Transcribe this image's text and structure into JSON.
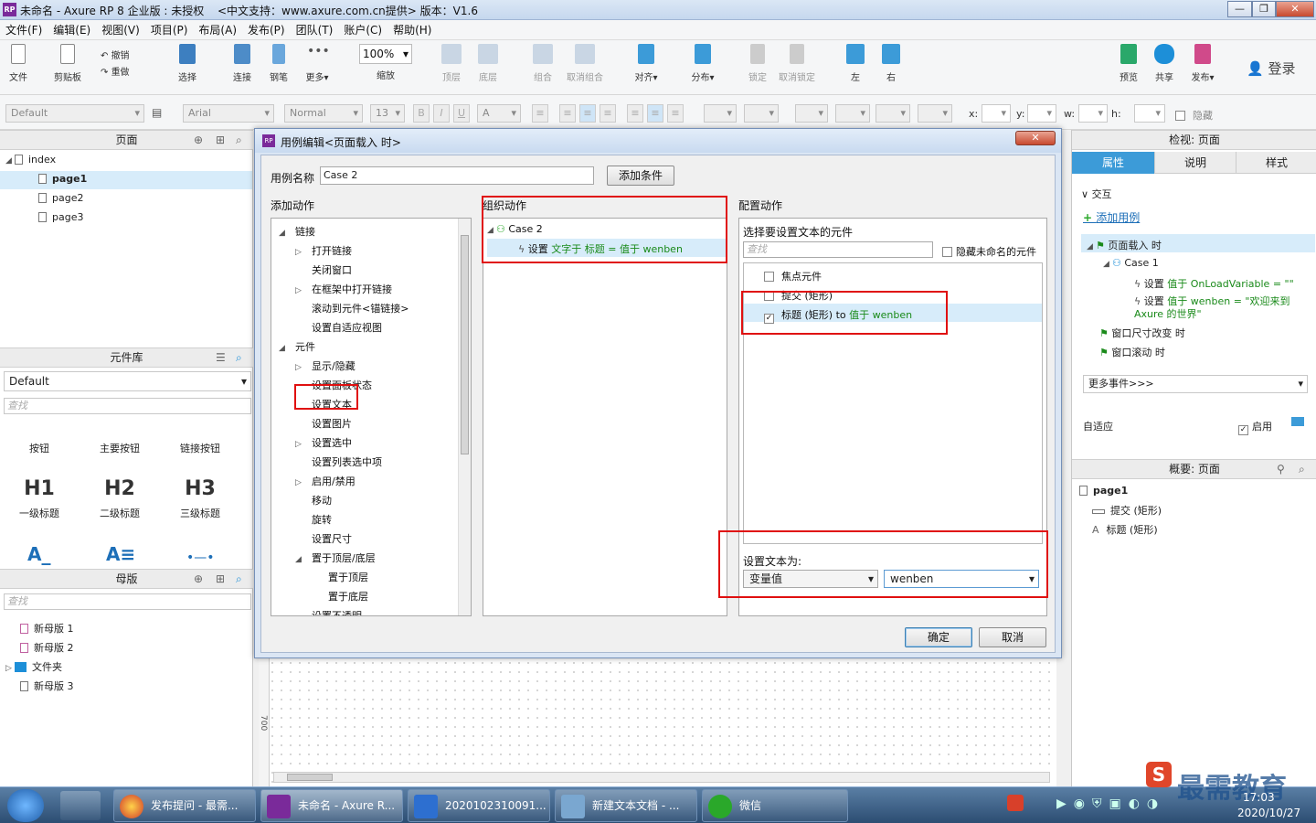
{
  "window": {
    "title": "未命名 - Axure RP 8 企业版 : 未授权",
    "subtitle": "<中文支持：www.axure.com.cn提供> 版本：V1.6"
  },
  "menu": [
    "文件(F)",
    "编辑(E)",
    "视图(V)",
    "项目(P)",
    "布局(A)",
    "发布(P)",
    "团队(T)",
    "账户(C)",
    "帮助(H)"
  ],
  "toolbar": {
    "file": "文件",
    "clipboard": "剪贴板",
    "undo": "撤销",
    "redo": "重做",
    "select": "选择",
    "connect": "连接",
    "pen": "钢笔",
    "more": "更多▾",
    "zoom_value": "100%",
    "zoom": "缩放",
    "top": "顶层",
    "bottom": "底层",
    "group": "组合",
    "ungroup": "取消组合",
    "align": "对齐▾",
    "distribute": "分布▾",
    "lock": "锁定",
    "unlock": "取消锁定",
    "left": "左",
    "right": "右",
    "preview": "预览",
    "share": "共享",
    "publish": "发布▾",
    "login": "登录"
  },
  "format": {
    "style": "Default",
    "font": "Arial",
    "weight": "Normal",
    "size": "13",
    "x": "x:",
    "y": "y:",
    "w": "w:",
    "h": "h:",
    "hide": "隐藏"
  },
  "pages": {
    "title": "页面",
    "root": "index",
    "items": [
      "page1",
      "page2",
      "page3"
    ]
  },
  "library": {
    "title": "元件库",
    "selected": "Default",
    "search": "查找",
    "widgets": [
      "按钮",
      "主要按钮",
      "链接按钮"
    ],
    "headings": [
      {
        "glyph": "H1",
        "label": "一级标题"
      },
      {
        "glyph": "H2",
        "label": "二级标题"
      },
      {
        "glyph": "H3",
        "label": "三级标题"
      }
    ]
  },
  "masters": {
    "title": "母版",
    "search": "查找",
    "items": [
      "新母版 1",
      "新母版 2",
      "文件夹",
      "新母版 3"
    ]
  },
  "dialog": {
    "title": "用例编辑<页面载入 时>",
    "case_name_label": "用例名称",
    "case_name_value": "Case 2",
    "add_condition": "添加条件",
    "add_actions": "添加动作",
    "organize_actions": "组织动作",
    "configure_actions": "配置动作",
    "action_tree": [
      {
        "label": "链接",
        "level": 0,
        "arrow": "◢"
      },
      {
        "label": "打开链接",
        "level": 1,
        "arrow": "▷"
      },
      {
        "label": "关闭窗口",
        "level": 1,
        "arrow": ""
      },
      {
        "label": "在框架中打开链接",
        "level": 1,
        "arrow": "▷"
      },
      {
        "label": "滚动到元件<锚链接>",
        "level": 1,
        "arrow": ""
      },
      {
        "label": "设置自适应视图",
        "level": 1,
        "arrow": ""
      },
      {
        "label": "元件",
        "level": 0,
        "arrow": "◢"
      },
      {
        "label": "显示/隐藏",
        "level": 1,
        "arrow": "▷"
      },
      {
        "label": "设置面板状态",
        "level": 1,
        "arrow": ""
      },
      {
        "label": "设置文本",
        "level": 1,
        "arrow": ""
      },
      {
        "label": "设置图片",
        "level": 1,
        "arrow": ""
      },
      {
        "label": "设置选中",
        "level": 1,
        "arrow": "▷"
      },
      {
        "label": "设置列表选中项",
        "level": 1,
        "arrow": ""
      },
      {
        "label": "启用/禁用",
        "level": 1,
        "arrow": "▷"
      },
      {
        "label": "移动",
        "level": 1,
        "arrow": ""
      },
      {
        "label": "旋转",
        "level": 1,
        "arrow": ""
      },
      {
        "label": "设置尺寸",
        "level": 1,
        "arrow": ""
      },
      {
        "label": "置于顶层/底层",
        "level": 1,
        "arrow": "◢"
      },
      {
        "label": "置于顶层",
        "level": 2,
        "arrow": ""
      },
      {
        "label": "置于底层",
        "level": 2,
        "arrow": ""
      },
      {
        "label": "设置不透明",
        "level": 1,
        "arrow": ""
      }
    ],
    "organize_case": "Case 2",
    "organize_action_prefix": "设置",
    "organize_action_detail": "文字于 标题 = 值于 wenben",
    "select_widget_label": "选择要设置文本的元件",
    "search": "查找",
    "hide_unnamed": "隐藏未命名的元件",
    "widget_list": [
      {
        "label": "焦点元件",
        "checked": false,
        "detail": ""
      },
      {
        "label": "提交 (矩形)",
        "checked": false,
        "detail": ""
      },
      {
        "label": "标题 (矩形) to",
        "checked": true,
        "detail": "值于 wenben"
      }
    ],
    "set_text_to": "设置文本为:",
    "value_type": "变量值",
    "variable": "wenben",
    "ok": "确定",
    "cancel": "取消"
  },
  "inspector": {
    "title": "检视: 页面",
    "tabs": [
      "属性",
      "说明",
      "样式"
    ],
    "interaction": "交互",
    "add_case": "添加用例",
    "event1": "页面载入 时",
    "case1": "Case 1",
    "action1_prefix": "设置",
    "action1_detail": "值于 OnLoadVariable = \"\"",
    "action2_prefix": "设置",
    "action2_detail": "值于 wenben = \"欢迎来到 Axure 的世界\"",
    "event2": "窗口尺寸改变 时",
    "event3": "窗口滚动 时",
    "more_events": "更多事件>>>",
    "adaptive": "自适应",
    "enable": "启用"
  },
  "outline": {
    "title": "概要: 页面",
    "page": "page1",
    "items": [
      "提交 (矩形)",
      "标题 (矩形)"
    ]
  },
  "canvas": {
    "ruler_mark": "700"
  },
  "taskbar": {
    "tasks": [
      "发布提问 - 最需...",
      "未命名 - Axure R...",
      "2020102310091...",
      "新建文本文档 - ...",
      "微信"
    ],
    "time": "17:03",
    "date": "2020/10/27",
    "watermark": "最需教育"
  },
  "colors": {
    "accent": "#3c9bd8",
    "highlight": "#d7ecfa",
    "red_annotation": "#e01010",
    "green_text": "#1a8a1a"
  }
}
